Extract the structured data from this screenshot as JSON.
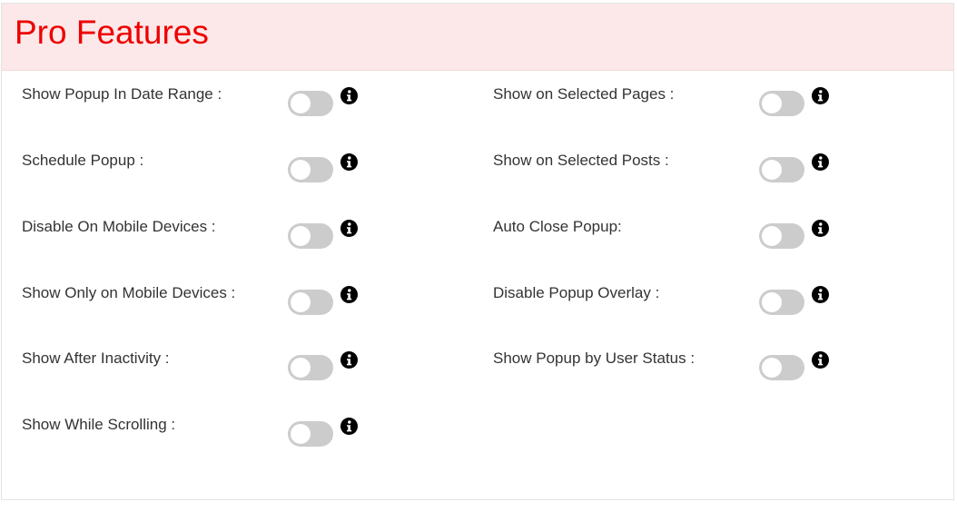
{
  "header": {
    "title": "Pro Features",
    "title_color": "#ee0000",
    "background": "#fce8e9"
  },
  "toggle_color": "#cccccc",
  "features": {
    "left": [
      {
        "label": "Show Popup In Date Range :",
        "enabled": false
      },
      {
        "label": "Schedule Popup :",
        "enabled": false
      },
      {
        "label": "Disable On Mobile Devices :",
        "enabled": false
      },
      {
        "label": "Show Only on Mobile Devices :",
        "enabled": false
      },
      {
        "label": "Show After Inactivity :",
        "enabled": false
      },
      {
        "label": "Show While Scrolling :",
        "enabled": false
      }
    ],
    "right": [
      {
        "label": "Show on Selected Pages :",
        "enabled": false
      },
      {
        "label": "Show on Selected Posts :",
        "enabled": false
      },
      {
        "label": "Auto Close Popup:",
        "enabled": false
      },
      {
        "label": "Disable Popup Overlay :",
        "enabled": false
      },
      {
        "label": "Show Popup by User Status :",
        "enabled": false
      }
    ]
  }
}
